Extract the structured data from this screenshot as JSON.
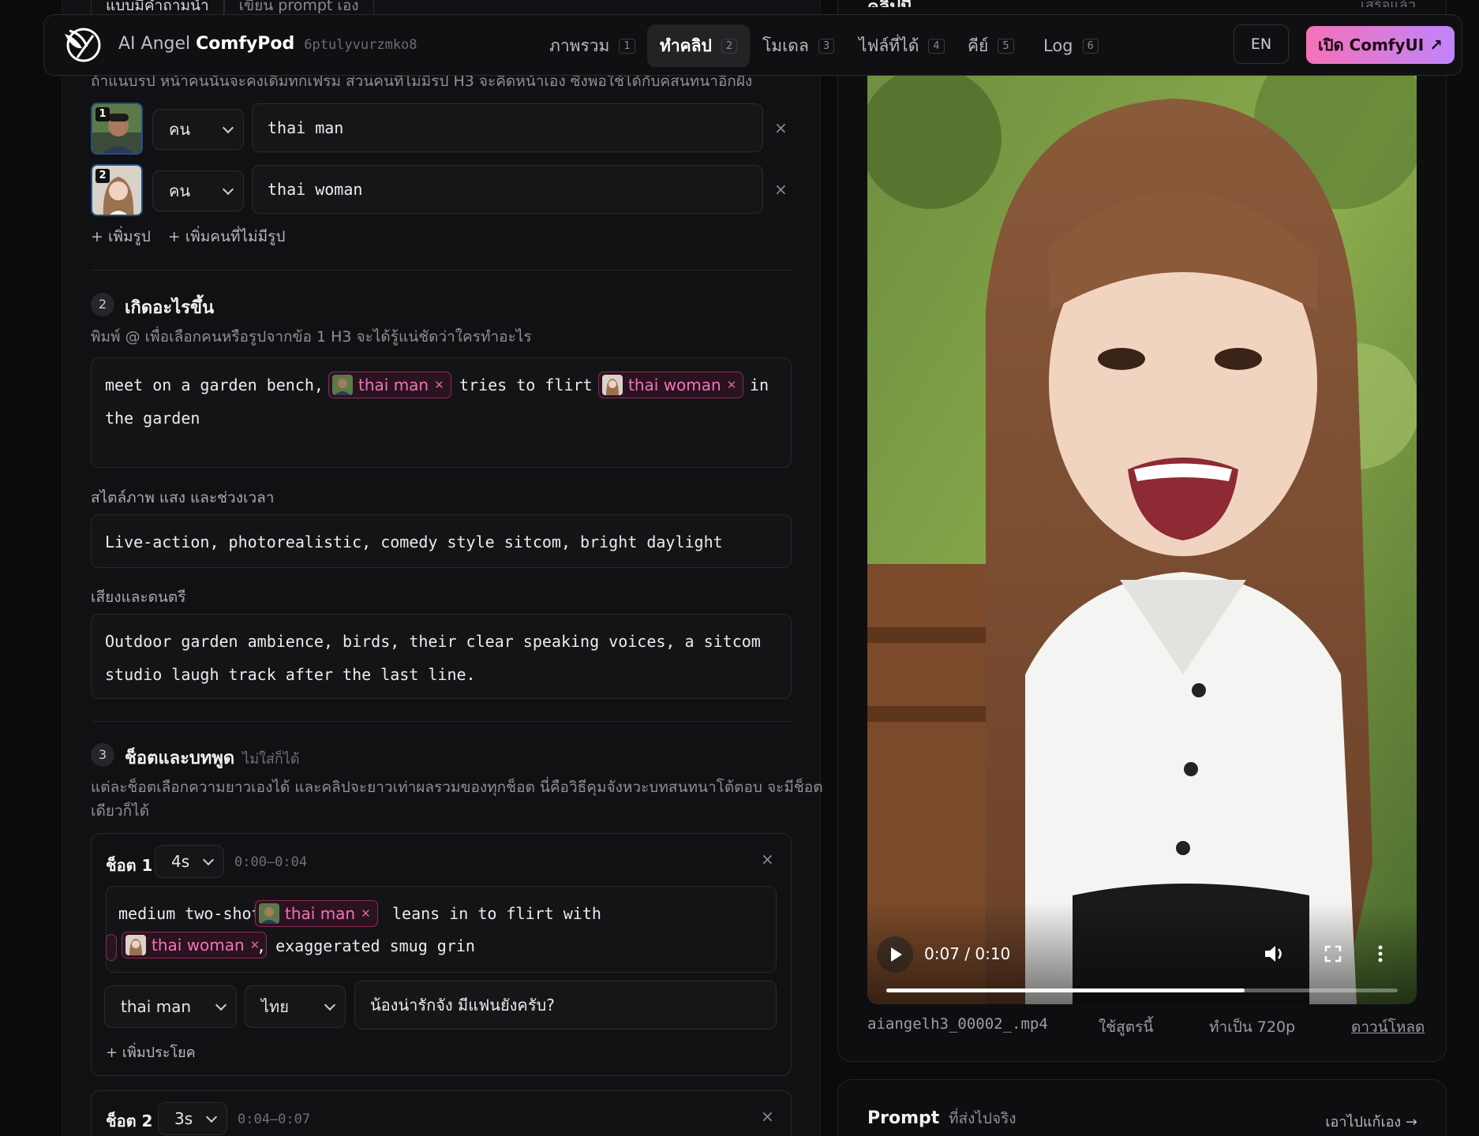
{
  "nav": {
    "brand_prefix": "AI Angel",
    "brand_name": "ComfyPod",
    "pod_id": "6ptulyvurzmko8",
    "tabs": [
      {
        "label": "ภาพรวม",
        "badge": "1"
      },
      {
        "label": "ทำคลิป",
        "badge": "2"
      },
      {
        "label": "โมเดล",
        "badge": "3"
      },
      {
        "label": "ไฟล์ที่ได้",
        "badge": "4"
      },
      {
        "label": "คีย์",
        "badge": "5"
      },
      {
        "label": "Log",
        "badge": "6"
      }
    ],
    "active_tab": "ทำคลิป",
    "lang": "EN",
    "open_label": "เปิด ComfyUI ↗"
  },
  "mode_tabs": [
    "แบบมีคำถามนำ",
    "เขียน prompt เอง"
  ],
  "people": {
    "note": "ถ้าแนบรูป หน้าคนนั้นจะคงเดิมทุกเฟรม ส่วนคนที่ไม่มีรูป H3 จะคิดหน้าเอง ซึ่งพอใช้ได้กับคู่สนทนาอีกฝั่ง",
    "rows": [
      {
        "num": "1",
        "type": "คน",
        "desc": "thai man"
      },
      {
        "num": "2",
        "type": "คน",
        "desc": "thai woman"
      }
    ],
    "add_photo": "+ เพิ่มรูป",
    "add_person": "+ เพิ่มคนที่ไม่มีรูป"
  },
  "step2": {
    "num": "2",
    "title": "เกิดอะไรขึ้น",
    "desc": "พิมพ์ @ เพื่อเลือกคนหรือรูปจากข้อ 1 H3 จะได้รู้แน่ชัดว่าใครทำอะไร",
    "scene": {
      "t1": "meet on a garden bench,",
      "chip1": "thai man",
      "t2": "tries to flirt",
      "chip2": "thai woman",
      "t3": "in",
      "t4": "the garden"
    },
    "style_label": "สไตล์ภาพ แสง และช่วงเวลา",
    "style_value": "Live-action, photorealistic, comedy style sitcom, bright daylight",
    "audio_label": "เสียงและดนตรี",
    "audio_line1": "Outdoor garden ambience, birds, their clear speaking voices, a sitcom",
    "audio_line2": "studio laugh track after the last line."
  },
  "step3": {
    "num": "3",
    "title": "ช็อตและบทพูด",
    "hint": "ไม่ใส่ก็ได้",
    "desc1": "แต่ละช็อตเลือกความยาวเองได้ และคลิปจะยาวเท่าผลรวมของทุกช็อต นี่คือวิธีคุมจังหวะบทสนทนาโต้ตอบ จะมีช็อต",
    "desc2": "เดียวก็ได้",
    "shot1": {
      "label": "ช็อต 1",
      "duration": "4s",
      "range": "0:00–0:04",
      "t1": "medium two-shot,",
      "chip1": "thai man",
      "t2": "leans in to flirt with",
      "chip2": "thai woman",
      "t3": ", exaggerated smug grin",
      "speaker": "thai man",
      "language": "ไทย",
      "line": "น้องน่ารักจัง มีแฟนยังครับ?",
      "add_line": "+ เพิ่มประโยค"
    },
    "shot2": {
      "label": "ช็อต 2",
      "duration": "3s",
      "range": "0:04–0:07"
    }
  },
  "preview": {
    "title": "คลิปนี้",
    "status": "เสร็จแล้ว",
    "time": "0:07 / 0:10",
    "progress": 0.7,
    "filename": "aiangelh3_00002_.mp4",
    "use_recipe": "ใช้สูตรนี้",
    "upscale": "ทำเป็น 720p",
    "download": "ดาวน์โหลด"
  },
  "prompt_card": {
    "title": "Prompt",
    "subtitle": "ที่ส่งไปจริง",
    "edit_link": "เอาไปแก้เอง →"
  },
  "colors": {
    "accent_pink": "#f472b6",
    "accent_purple": "#c084fc",
    "background": "#0b0b0c"
  }
}
